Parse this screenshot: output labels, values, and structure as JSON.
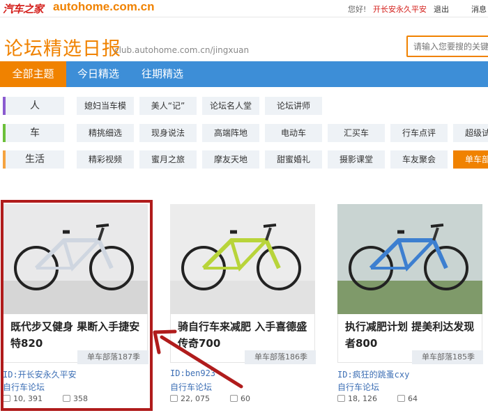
{
  "topbar": {
    "logo_cn": "汽车之家",
    "logo_url": "autohome.com.cn",
    "greeting": "您好!",
    "username": "开长安永久平安",
    "logout": "退出",
    "messages": "消息"
  },
  "header": {
    "title": "论坛精选日报",
    "url": "club.autohome.com.cn/jingxuan",
    "search_placeholder": "请输入您要搜的关键词"
  },
  "nav": {
    "tabs": [
      "全部主题",
      "今日精选",
      "往期精选"
    ],
    "active": 0
  },
  "categories": [
    {
      "label": "人",
      "color": "#8b5bd0",
      "items": [
        "媳妇当车模",
        "美人“记”",
        "论坛名人堂",
        "论坛讲师"
      ]
    },
    {
      "label": "车",
      "color": "#6cbf3a",
      "items": [
        "精挑细选",
        "现身说法",
        "高端阵地",
        "电动车",
        "汇买车",
        "行车点评",
        "超级试驾"
      ]
    },
    {
      "label": "生活",
      "color": "#f5a340",
      "items": [
        "精彩视频",
        "蜜月之旅",
        "摩友天地",
        "甜蜜婚礼",
        "摄影课堂",
        "车友聚会",
        "单车部落"
      ]
    }
  ],
  "cards": [
    {
      "title": "既代步又健身 果断入手捷安特820",
      "tag": "单车部落187季",
      "author": "ID:开长安永久平安",
      "forum": "自行车论坛",
      "views": "10, 391",
      "replies": "358",
      "frame_color": "#ffffff",
      "accent": "#cfd6e0"
    },
    {
      "title": "骑自行车来减肥 入手喜德盛传奇700",
      "tag": "单车部落186季",
      "author": "ID:ben923",
      "forum": "自行车论坛",
      "views": "22, 075",
      "replies": "60",
      "frame_color": "#1d2a1f",
      "accent": "#b8d43a"
    },
    {
      "title": "执行减肥计划 提美利达发现者800",
      "tag": "单车部落185季",
      "author": "ID:疯狂的跳蚤cxy",
      "forum": "自行车论坛",
      "views": "18, 126",
      "replies": "64",
      "frame_color": "#f2f2f2",
      "accent": "#3d7fd0"
    }
  ],
  "icons": {
    "views": "thumb-icon",
    "replies": "comment-icon",
    "annotation": "red-arrow"
  },
  "colors": {
    "brand_orange": "#f08200",
    "nav_blue": "#3d8ed7",
    "highlight_red": "#b01c1c",
    "link_blue": "#3d6fb5"
  }
}
